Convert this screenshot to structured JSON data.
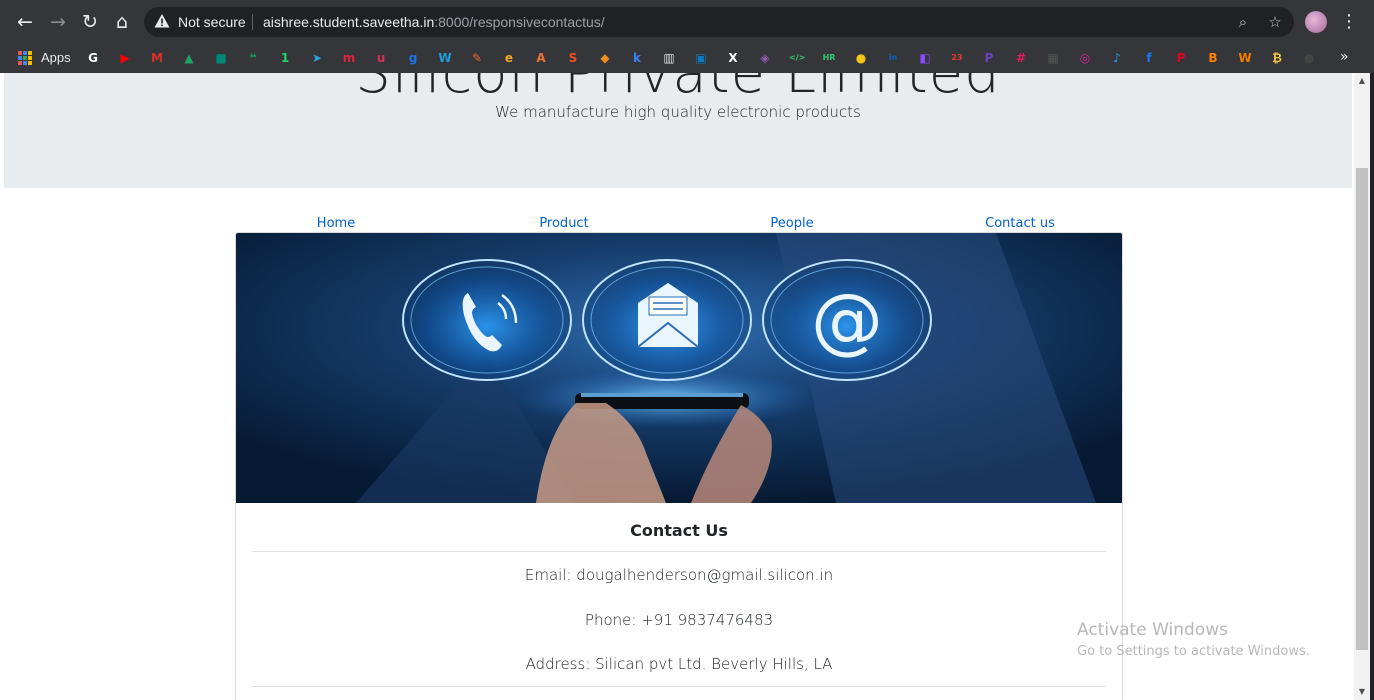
{
  "browser": {
    "security_label": "Not secure",
    "url_host": "aishree.student.saveetha.in",
    "url_rest": ":8000/responsivecontactus/",
    "bookmarks_apps_label": "Apps",
    "icons": {
      "back": "back-arrow-icon",
      "forward": "forward-arrow-icon",
      "reload": "reload-icon",
      "home": "home-icon",
      "zoom": "zoom-icon",
      "star": "bookmark-star-icon",
      "menu": "kebab-menu-icon",
      "more": "chevron-double-right-icon"
    },
    "bookmarks": [
      {
        "name": "google",
        "glyph": "G",
        "color": "#ffffff"
      },
      {
        "name": "youtube",
        "glyph": "▶",
        "color": "#ff0000"
      },
      {
        "name": "gmail",
        "glyph": "M",
        "color": "#d93025"
      },
      {
        "name": "google-drive",
        "glyph": "▲",
        "color": "#1fa463"
      },
      {
        "name": "google-meet",
        "glyph": "■",
        "color": "#00897b"
      },
      {
        "name": "hangouts",
        "glyph": "❝",
        "color": "#0f9d58"
      },
      {
        "name": "whatsapp",
        "glyph": "1",
        "color": "#25d366"
      },
      {
        "name": "telegram",
        "glyph": "➤",
        "color": "#2aa3df"
      },
      {
        "name": "m-app",
        "glyph": "m",
        "color": "#e0233a"
      },
      {
        "name": "u-app",
        "glyph": "u",
        "color": "#d9304c"
      },
      {
        "name": "g-app",
        "glyph": "g",
        "color": "#1a73e8"
      },
      {
        "name": "w-app",
        "glyph": "W",
        "color": "#1a9fd9"
      },
      {
        "name": "quill",
        "glyph": "✎",
        "color": "#f06a35"
      },
      {
        "name": "e-app",
        "glyph": "e",
        "color": "#f5a623"
      },
      {
        "name": "a-app",
        "glyph": "A",
        "color": "#e7743b"
      },
      {
        "name": "s-app",
        "glyph": "S",
        "color": "#f25022"
      },
      {
        "name": "box",
        "glyph": "◆",
        "color": "#f28b20"
      },
      {
        "name": "k-app",
        "glyph": "k",
        "color": "#3b82f6"
      },
      {
        "name": "chart",
        "glyph": "▥",
        "color": "#dddddd"
      },
      {
        "name": "media",
        "glyph": "▣",
        "color": "#0a7cc1"
      },
      {
        "name": "x-app",
        "glyph": "X",
        "color": "#ffffff"
      },
      {
        "name": "shield",
        "glyph": "◈",
        "color": "#9b59b6"
      },
      {
        "name": "code",
        "glyph": "</>",
        "color": "#2ecc71"
      },
      {
        "name": "hr",
        "glyph": "HR",
        "color": "#2ecc71"
      },
      {
        "name": "coin",
        "glyph": "●",
        "color": "#f5c518"
      },
      {
        "name": "linkedin",
        "glyph": "in",
        "color": "#0a66c2"
      },
      {
        "name": "twitch",
        "glyph": "◧",
        "color": "#9146ff"
      },
      {
        "name": "calendar",
        "glyph": "23",
        "color": "#e53935"
      },
      {
        "name": "p-app",
        "glyph": "P",
        "color": "#6f42c1"
      },
      {
        "name": "slack",
        "glyph": "#",
        "color": "#e01e5a"
      },
      {
        "name": "tile",
        "glyph": "▦",
        "color": "#555555"
      },
      {
        "name": "instagram",
        "glyph": "◎",
        "color": "#d6249f"
      },
      {
        "name": "twitter",
        "glyph": "♪",
        "color": "#1da1f2"
      },
      {
        "name": "facebook",
        "glyph": "f",
        "color": "#1877f2"
      },
      {
        "name": "pinterest",
        "glyph": "P",
        "color": "#e60023"
      },
      {
        "name": "blogger",
        "glyph": "B",
        "color": "#ff8000"
      },
      {
        "name": "w2-app",
        "glyph": "W",
        "color": "#f57c00"
      },
      {
        "name": "b-app",
        "glyph": "₿",
        "color": "#f7c948"
      },
      {
        "name": "github",
        "glyph": "●",
        "color": "#444444"
      }
    ]
  },
  "page": {
    "title": "Silicon Private Limited",
    "subtitle": "We manufacture high quality electronic products",
    "nav": [
      "Home",
      "Product",
      "People",
      "Contact us"
    ],
    "card": {
      "heading": "Contact Us",
      "email": "Email: dougalhenderson@gmail.silicon.in",
      "phone": "Phone: +91 9837476483",
      "address": "Address: Silican pvt Ltd. Beverly Hills, LA"
    }
  },
  "overlay": {
    "activate_title": "Activate Windows",
    "activate_sub": "Go to Settings to activate Windows."
  }
}
